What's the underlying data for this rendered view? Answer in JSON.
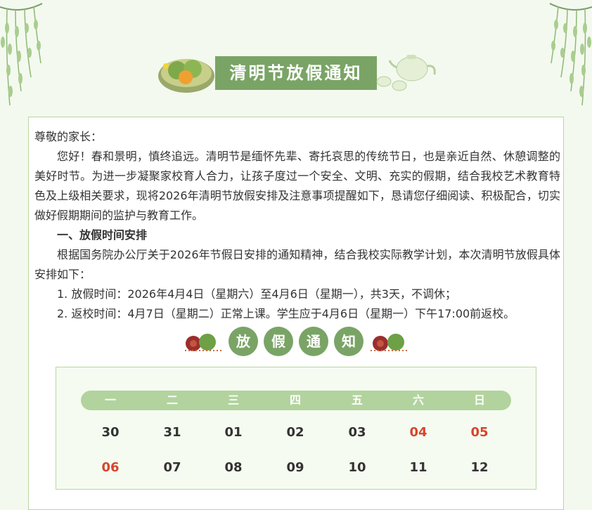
{
  "header": {
    "title": "清明节放假通知"
  },
  "letter": {
    "greeting": "尊敬的家长：",
    "paragraph1": "您好！春和景明，慎终追远。清明节是缅怀先辈、寄托哀思的传统节日，也是亲近自然、休憩调整的美好时节。为进一步凝聚家校育人合力，让孩子度过一个安全、文明、充实的假期，结合我校艺术教育特色及上级相关要求，现将2026年清明节放假安排及注意事项提醒如下，恳请您仔细阅读、积极配合，切实做好假期期间的监护与教育工作。",
    "section1_title": "一、放假时间安排",
    "paragraph2": "根据国务院办公厅关于2026年节假日安排的通知精神，结合我校实际教学计划，本次清明节放假具体安排如下：",
    "item1": "1.  放假时间：2026年4月4日（星期六）至4月6日（星期一），共3天，不调休；",
    "item2": "2.  返校时间：4月7日（星期二）正常上课。学生应于4月6日（星期一）下午17:00前返校。"
  },
  "banner": {
    "chars": [
      "放",
      "假",
      "通",
      "知"
    ]
  },
  "calendar": {
    "weekdays": [
      "一",
      "二",
      "三",
      "四",
      "五",
      "六",
      "日"
    ],
    "row1": [
      "30",
      "31",
      "01",
      "02",
      "03",
      "04",
      "05"
    ],
    "row2": [
      "06",
      "07",
      "08",
      "09",
      "10",
      "11",
      "12"
    ],
    "holiday_color": "#d9442b"
  },
  "colors": {
    "accent": "#7aa466",
    "weekbar": "#b2d39e",
    "border": "#b9d6a3"
  }
}
